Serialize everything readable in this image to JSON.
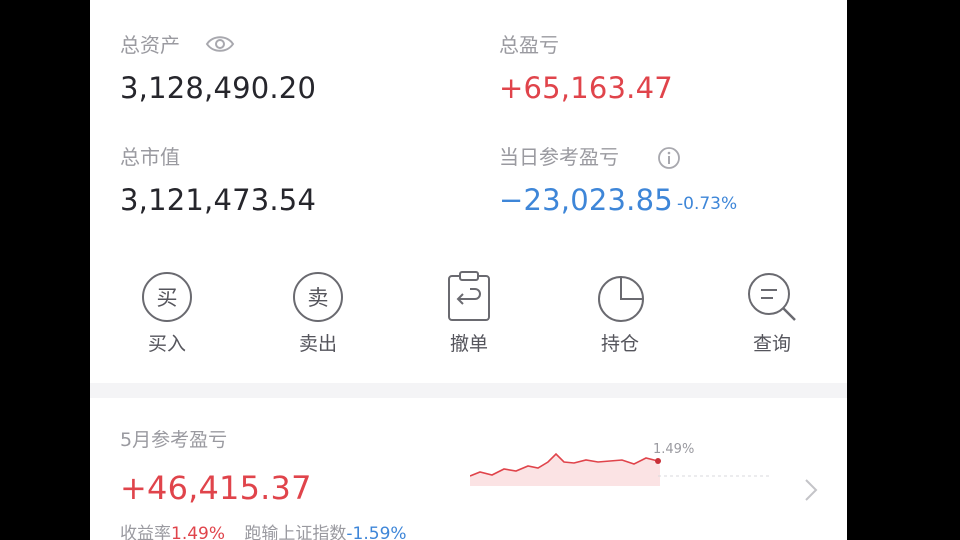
{
  "summary": {
    "total_assets_label": "总资产",
    "total_assets_value": "3,128,490.20",
    "total_pl_label": "总盈亏",
    "total_pl_value": "+65,163.47",
    "market_value_label": "总市值",
    "market_value_value": "3,121,473.54",
    "daily_pl_label": "当日参考盈亏",
    "daily_pl_value": "−23,023.85",
    "daily_pl_pct": "-0.73%"
  },
  "icons": {
    "visibility": "eye-icon",
    "info": "info-icon"
  },
  "actions": [
    {
      "label": "买入",
      "glyph": "买",
      "icon": "buy-icon"
    },
    {
      "label": "卖出",
      "glyph": "卖",
      "icon": "sell-icon"
    },
    {
      "label": "撤单",
      "icon": "cancel-order-icon"
    },
    {
      "label": "持仓",
      "icon": "pie-chart-icon"
    },
    {
      "label": "查询",
      "icon": "search-icon"
    }
  ],
  "monthly": {
    "title": "5月参考盈亏",
    "value": "+46,415.37",
    "return_label": "收益率",
    "return_value": "1.49%",
    "benchmark_label": "跑输上证指数",
    "benchmark_value": "-1.59%",
    "sparkline_end_label": "1.49%"
  },
  "colors": {
    "gain": "#e0444b",
    "loss": "#3e86d8",
    "muted": "#9a9aa0"
  }
}
